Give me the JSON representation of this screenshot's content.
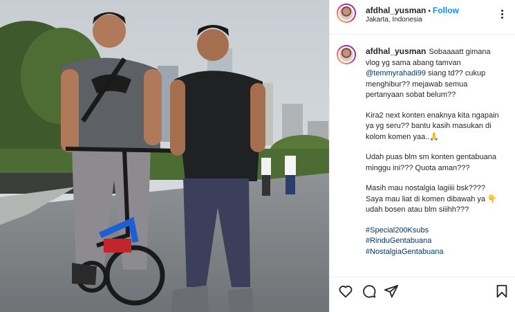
{
  "post": {
    "username": "afdhal_yusman",
    "separator": "•",
    "follow_label": "Follow",
    "location": "Jakarta, Indonesia"
  },
  "caption": {
    "username": "afdhal_yusman",
    "p1_pre": "Sobaaaatt gimana vlog yg sama abang tamvan ",
    "p1_mention": "@temmyrahadi99",
    "p1_post": " siang td?? cukup menghibur?? mejawab semua pertanyaan sobat belum??",
    "p2": "Kira2 next konten enaknya kita ngapain ya yg seru?? bantu kasih masukan di kolom komen yaa..🙏",
    "p3": "Udah puas blm sm konten gentabuana minggu ini??? Quota aman???",
    "p4": "Masih mau nostalgia lagiiii bsk???? Saya mau liat di komen dibawah ya 👇 udah bosen atau blm siiihh???",
    "hashtags": [
      "#Special200Ksubs",
      "#RinduGentabuana",
      "#NostalgiaGentabuana"
    ]
  },
  "icons": {
    "like": "heart-icon",
    "comment": "comment-icon",
    "share": "send-icon",
    "save": "bookmark-icon",
    "more": "more-options-icon"
  },
  "colors": {
    "link_blue": "#0095f6",
    "hashtag": "#00376b",
    "text": "#262626",
    "border": "#efefef"
  }
}
